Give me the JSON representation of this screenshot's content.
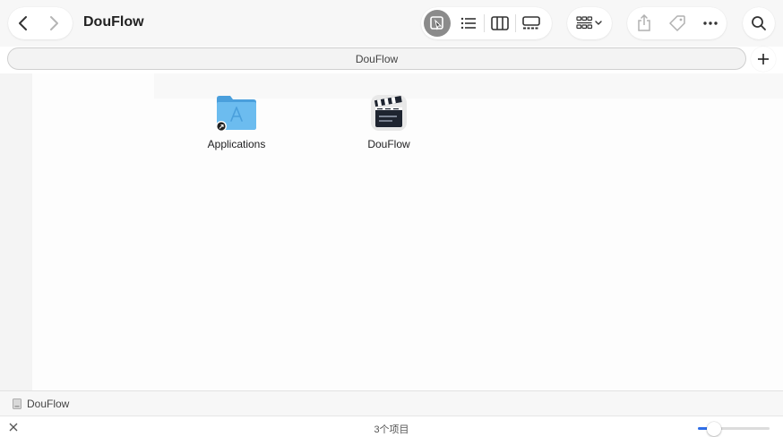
{
  "window": {
    "title": "DouFlow"
  },
  "pathbar": {
    "label": "DouFlow"
  },
  "items": [
    {
      "name": "Applications",
      "icon": "applications-folder-alias-icon"
    },
    {
      "name": "DouFlow",
      "icon": "clapperboard-app-icon"
    }
  ],
  "status_path": {
    "label": "DouFlow"
  },
  "status": {
    "count": "3个项目"
  },
  "zoom": {
    "level": 0.23
  },
  "colors": {
    "accent": "#2f6ee8",
    "folder": "#5aaee6"
  }
}
